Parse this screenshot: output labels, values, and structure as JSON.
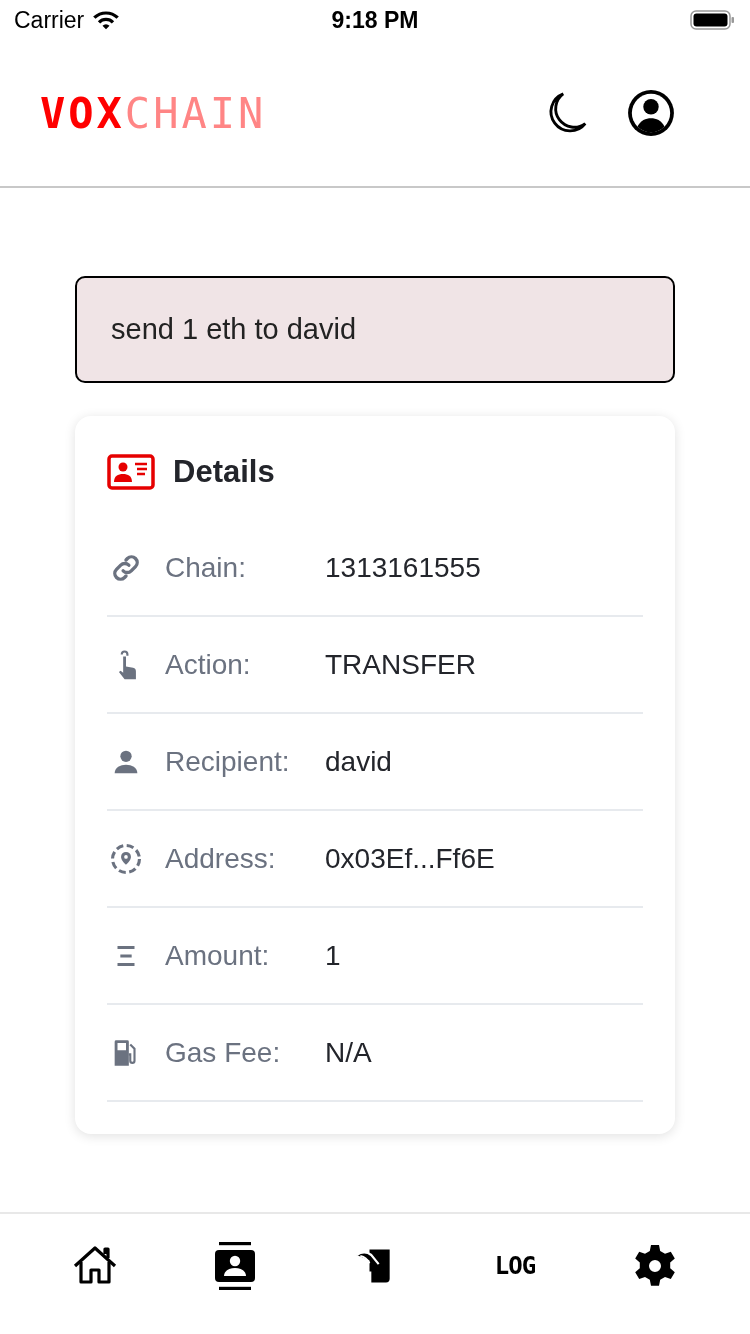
{
  "status_bar": {
    "carrier": "Carrier",
    "time": "9:18 PM"
  },
  "header": {
    "logo": {
      "first": "VOX",
      "second": "CHAIN"
    }
  },
  "prompt": {
    "value": "send 1 eth to david"
  },
  "details": {
    "title": "Details",
    "rows": [
      {
        "kind": "chain",
        "label": "Chain:",
        "value": "1313161555"
      },
      {
        "kind": "action",
        "label": "Action:",
        "value": "TRANSFER"
      },
      {
        "kind": "recipient",
        "label": "Recipient:",
        "value": "david"
      },
      {
        "kind": "address",
        "label": "Address:",
        "value": "0x03Ef...Ff6E"
      },
      {
        "kind": "amount",
        "label": "Amount:",
        "value": "1"
      },
      {
        "kind": "gas",
        "label": "Gas Fee:",
        "value": "N/A"
      }
    ]
  },
  "tab_bar": [
    {
      "kind": "home"
    },
    {
      "kind": "contacts"
    },
    {
      "kind": "sign"
    },
    {
      "kind": "text",
      "label": "LOG"
    },
    {
      "kind": "settings"
    }
  ]
}
